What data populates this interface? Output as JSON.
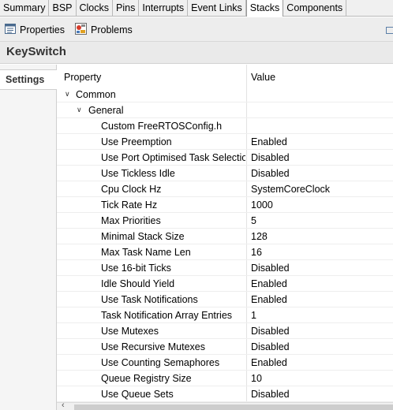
{
  "top_tabs": [
    "Summary",
    "BSP",
    "Clocks",
    "Pins",
    "Interrupts",
    "Event Links",
    "Stacks",
    "Components"
  ],
  "active_tab_index": 6,
  "views": {
    "properties_label": "Properties",
    "problems_label": "Problems"
  },
  "page_title": "KeySwitch",
  "left_tab": "Settings",
  "table": {
    "header_property": "Property",
    "header_value": "Value",
    "group_common": "Common",
    "group_general": "General",
    "rows": [
      {
        "key": "Custom FreeRTOSConfig.h",
        "value": ""
      },
      {
        "key": "Use Preemption",
        "value": "Enabled"
      },
      {
        "key": "Use Port Optimised Task Selection",
        "value": "Disabled"
      },
      {
        "key": "Use Tickless Idle",
        "value": "Disabled"
      },
      {
        "key": "Cpu Clock Hz",
        "value": "SystemCoreClock"
      },
      {
        "key": "Tick Rate Hz",
        "value": "1000"
      },
      {
        "key": "Max Priorities",
        "value": "5"
      },
      {
        "key": "Minimal Stack Size",
        "value": "128"
      },
      {
        "key": "Max Task Name Len",
        "value": "16"
      },
      {
        "key": "Use 16-bit Ticks",
        "value": "Disabled"
      },
      {
        "key": "Idle Should Yield",
        "value": "Enabled"
      },
      {
        "key": "Use Task Notifications",
        "value": "Enabled"
      },
      {
        "key": "Task Notification Array Entries",
        "value": "1"
      },
      {
        "key": "Use Mutexes",
        "value": "Disabled"
      },
      {
        "key": "Use Recursive Mutexes",
        "value": "Disabled"
      },
      {
        "key": "Use Counting Semaphores",
        "value": "Enabled"
      },
      {
        "key": "Queue Registry Size",
        "value": "10"
      },
      {
        "key": "Use Queue Sets",
        "value": "Disabled"
      }
    ]
  }
}
